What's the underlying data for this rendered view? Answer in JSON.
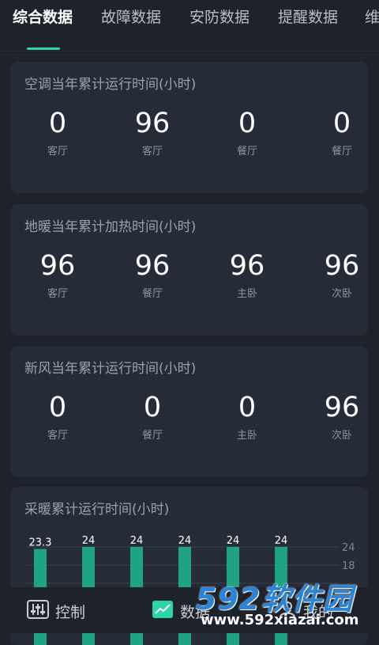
{
  "tabs": [
    "综合数据",
    "故障数据",
    "安防数据",
    "提醒数据",
    "维"
  ],
  "cards": [
    {
      "title": "空调当年累计运行时间(小时)",
      "metrics": [
        {
          "value": "0",
          "room": "客厅"
        },
        {
          "value": "96",
          "room": "客厅"
        },
        {
          "value": "0",
          "room": "餐厅"
        },
        {
          "value": "0",
          "room": "餐厅"
        }
      ]
    },
    {
      "title": "地暖当年累计加热时间(小时)",
      "metrics": [
        {
          "value": "96",
          "room": "客厅"
        },
        {
          "value": "96",
          "room": "餐厅"
        },
        {
          "value": "96",
          "room": "主卧"
        },
        {
          "value": "96",
          "room": "次卧"
        }
      ]
    },
    {
      "title": "新风当年累计运行时间(小时)",
      "metrics": [
        {
          "value": "0",
          "room": "客厅"
        },
        {
          "value": "0",
          "room": "餐厅"
        },
        {
          "value": "0",
          "room": "主卧"
        },
        {
          "value": "96",
          "room": "次卧"
        }
      ]
    }
  ],
  "heating_chart": {
    "title": "采暖累计运行时间(小时)",
    "bar_values": [
      23.3,
      24,
      24,
      24,
      24,
      24
    ],
    "bar_labels": [
      "23.3",
      "24",
      "24",
      "24",
      "24",
      "24"
    ],
    "y_ticks": [
      "24",
      "18"
    ],
    "bar_color": "#1fa383"
  },
  "bottom_nav": [
    {
      "label": "控制",
      "icon": "sliders-icon"
    },
    {
      "label": "数据",
      "icon": "chart-icon"
    },
    {
      "label": "我的",
      "icon": "user-icon"
    }
  ],
  "watermark": {
    "text": "592软件园",
    "url": "www.592xiazai.com"
  }
}
